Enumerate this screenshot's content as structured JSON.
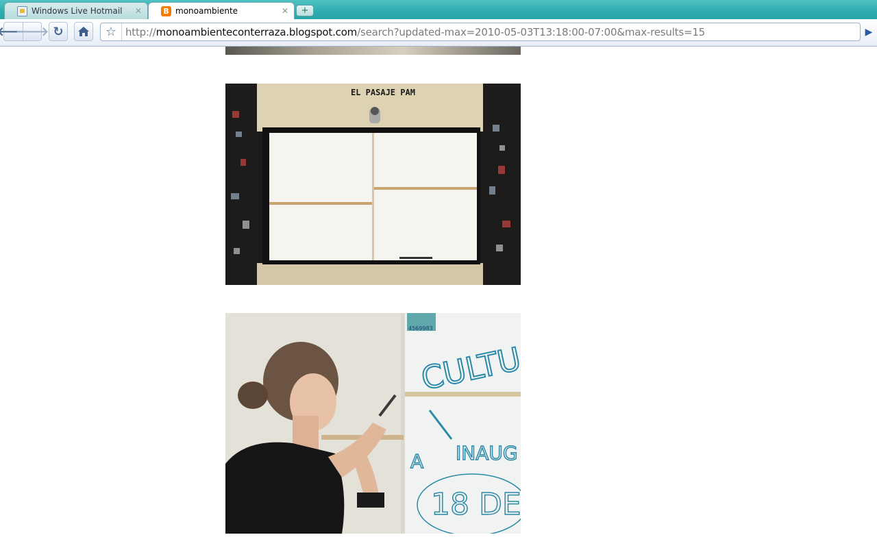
{
  "browser": {
    "tabs": [
      {
        "title": "Windows Live Hotmail",
        "icon": "hotmail-icon",
        "active": false
      },
      {
        "title": "monoambiente",
        "icon": "blogger-icon",
        "active": true
      }
    ],
    "address": {
      "scheme": "http://",
      "host": "monoambienteconterraza.blogspot.com",
      "path": "/search?updated-max=2010-05-03T13:18:00-07:00&max-results=15"
    }
  },
  "post_images": {
    "board_sign": "EL PASAJE PAM",
    "wall_writing": {
      "line1": "CULTU",
      "line2": "A",
      "line3": "INAUG",
      "line4": "18 DE"
    },
    "sticker_number": "4569983"
  },
  "colors": {
    "tabstrip": "#31aeb0",
    "blogger_orange": "#f57d00",
    "marker_blue": "#2a8aa8"
  }
}
